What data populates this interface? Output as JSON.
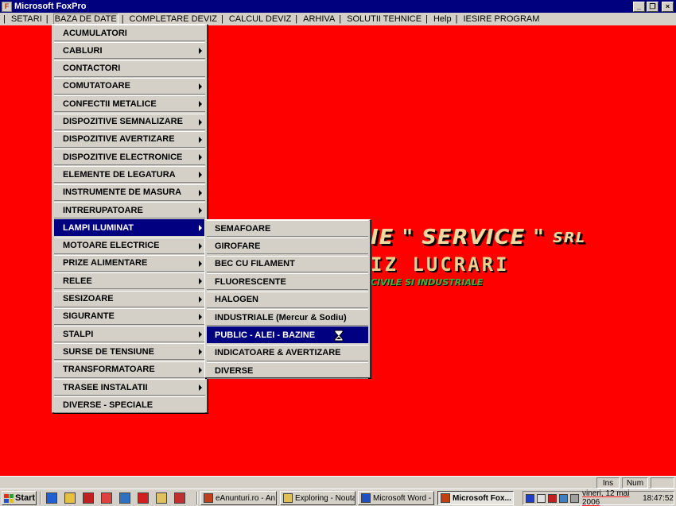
{
  "window": {
    "title": "Microsoft FoxPro",
    "minimize_glyph": "_",
    "restore_glyph": "❐",
    "close_glyph": "×"
  },
  "menubar": {
    "separator": "|",
    "items": [
      {
        "label": "SETARI"
      },
      {
        "label": "BAZA DE DATE"
      },
      {
        "label": "COMPLETARE DEVIZ"
      },
      {
        "label": "CALCUL DEVIZ"
      },
      {
        "label": "ARHIVA"
      },
      {
        "label": "SOLUTII TEHNICE"
      },
      {
        "label": "Help"
      },
      {
        "label": "IESIRE PROGRAM"
      }
    ]
  },
  "background_logo": {
    "line1": "IE \" SERVICE \"",
    "line1_suffix": "SRL",
    "line2": "IZ LUCRARI",
    "line3": "CIVILE SI INDUSTRIALE"
  },
  "baza_de_date_menu": {
    "items": [
      {
        "label": "ACUMULATORI",
        "submenu": false
      },
      {
        "label": "CABLURI",
        "submenu": true
      },
      {
        "label": "CONTACTORI",
        "submenu": false
      },
      {
        "label": "COMUTATOARE",
        "submenu": true
      },
      {
        "label": "CONFECTII METALICE",
        "submenu": true
      },
      {
        "label": "DISPOZITIVE SEMNALIZARE",
        "submenu": true
      },
      {
        "label": "DISPOZITIVE AVERTIZARE",
        "submenu": true
      },
      {
        "label": "DISPOZITIVE ELECTRONICE",
        "submenu": true
      },
      {
        "label": "ELEMENTE DE LEGATURA",
        "submenu": true
      },
      {
        "label": "INSTRUMENTE DE MASURA",
        "submenu": true
      },
      {
        "label": "INTRERUPATOARE",
        "submenu": true
      },
      {
        "label": "LAMPI ILUMINAT",
        "submenu": true,
        "selected": true
      },
      {
        "label": "MOTOARE ELECTRICE",
        "submenu": true
      },
      {
        "label": "PRIZE ALIMENTARE",
        "submenu": true
      },
      {
        "label": "RELEE",
        "submenu": true
      },
      {
        "label": "SESIZOARE",
        "submenu": true
      },
      {
        "label": "SIGURANTE",
        "submenu": true
      },
      {
        "label": "STALPI",
        "submenu": true
      },
      {
        "label": "SURSE DE TENSIUNE",
        "submenu": true
      },
      {
        "label": "TRANSFORMATOARE",
        "submenu": true
      },
      {
        "label": "TRASEE INSTALATII",
        "submenu": true
      },
      {
        "label": "DIVERSE - SPECIALE",
        "submenu": false
      }
    ]
  },
  "lampi_iluminat_submenu": {
    "items": [
      {
        "label": "SEMAFOARE"
      },
      {
        "label": "GIROFARE"
      },
      {
        "label": "BEC CU FILAMENT"
      },
      {
        "label": "FLUORESCENTE"
      },
      {
        "label": "HALOGEN"
      },
      {
        "label": "INDUSTRIALE (Mercur & Sodiu)"
      },
      {
        "label": "PUBLIC - ALEI - BAZINE",
        "selected": true
      },
      {
        "label": "INDICATOARE & AVERTIZARE"
      },
      {
        "label": "DIVERSE"
      }
    ]
  },
  "statusbar": {
    "ins": "Ins",
    "num": "Num"
  },
  "taskbar": {
    "start_label": "Start",
    "quick_launch": [
      "ie-icon",
      "outlook-icon",
      "media-icon",
      "app-icon",
      "desktop-icon",
      "opera-icon",
      "explorer-icon",
      "pdf-icon"
    ],
    "tasks": [
      {
        "label": "eAnunturi.ro - An...",
        "icon_color": "#c04020"
      },
      {
        "label": "Exploring - Noutati",
        "icon_color": "#e0c050"
      },
      {
        "label": "Microsoft Word - ...",
        "icon_color": "#2050c0"
      },
      {
        "label": "Microsoft Fox...",
        "icon_color": "#c04010",
        "active": true
      }
    ],
    "tray_date": "vineri, 12 mai 2006",
    "tray_time": "18:47:52"
  }
}
